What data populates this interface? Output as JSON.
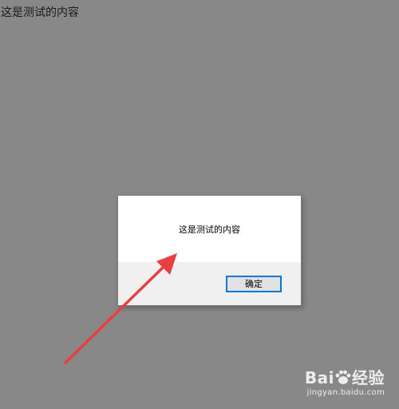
{
  "page": {
    "text": "这是测试的内容"
  },
  "dialog": {
    "message": "这是测试的内容",
    "ok_label": "确定"
  },
  "watermark": {
    "brand_prefix": "Bai",
    "brand_suffix": "经验",
    "url": "jingyan.baidu.com",
    "icon": "paw-icon"
  },
  "annotation": {
    "color": "#e84040",
    "icon": "arrow-icon"
  }
}
